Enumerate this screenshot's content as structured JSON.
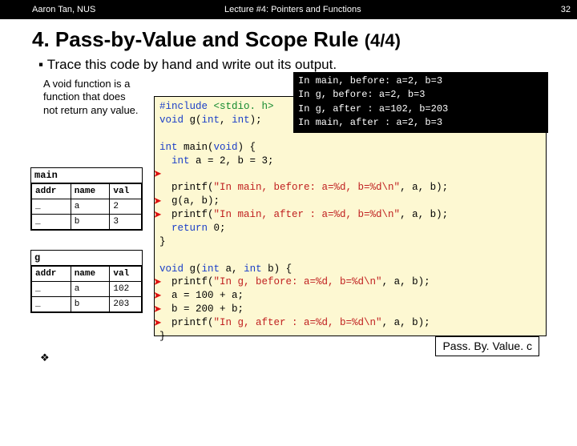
{
  "topbar": {
    "author": "Aaron Tan, NUS",
    "lecture": "Lecture #4: Pointers and Functions",
    "page": "32"
  },
  "title": {
    "num": "4.",
    "text": "Pass-by-Value and Scope Rule",
    "suffix": "(4/4)"
  },
  "instruction": "Trace this code by hand and write out its output.",
  "note": "A void function is a function that does not return any value.",
  "tables": {
    "main": {
      "caption": "main",
      "headers": [
        "addr",
        "name",
        "val"
      ],
      "rows": [
        [
          "_",
          "a",
          "2"
        ],
        [
          "_",
          "b",
          "3"
        ]
      ]
    },
    "g": {
      "caption": "g",
      "headers": [
        "addr",
        "name",
        "val"
      ],
      "rows": [
        [
          "_",
          "a",
          "102"
        ],
        [
          "_",
          "b",
          "203"
        ]
      ]
    }
  },
  "code": {
    "l1a": "#include",
    "l1b": " <stdio. h>",
    "l2a": "void",
    "l2b": " g(",
    "l2c": "int",
    "l2d": ", ",
    "l2e": "int",
    "l2f": ");",
    "l4a": "int",
    "l4b": " main(",
    "l4c": "void",
    "l4d": ") {",
    "l5a": "  int",
    "l5b": " a = 2, b = 3;",
    "l7a": "  printf(",
    "l7b": "\"In main, before: a=%d, b=%d\\n\"",
    "l7c": ", a, b);",
    "l8": "  g(a, b);",
    "l9a": "  printf(",
    "l9b": "\"In main, after : a=%d, b=%d\\n\"",
    "l9c": ", a, b);",
    "l10a": "  return",
    "l10b": " 0;",
    "l11": "}",
    "l13a": "void",
    "l13b": " g(",
    "l13c": "int",
    "l13d": " a, ",
    "l13e": "int",
    "l13f": " b) {",
    "l14a": "  printf(",
    "l14b": "\"In g, before: a=%d, b=%d\\n\"",
    "l14c": ", a, b);",
    "l15": "  a = 100 + a;",
    "l16": "  b = 200 + b;",
    "l17a": "  printf(",
    "l17b": "\"In g, after : a=%d, b=%d\\n\"",
    "l17c": ", a, b);",
    "l18": "}"
  },
  "output": {
    "o1": "In main, before: a=2, b=3",
    "o2": "In g, before: a=2, b=3",
    "o3": "In g, after : a=102, b=203",
    "o4": "In main, after : a=2, b=3"
  },
  "filetag": "Pass. By. Value. c",
  "diamond": "❖"
}
